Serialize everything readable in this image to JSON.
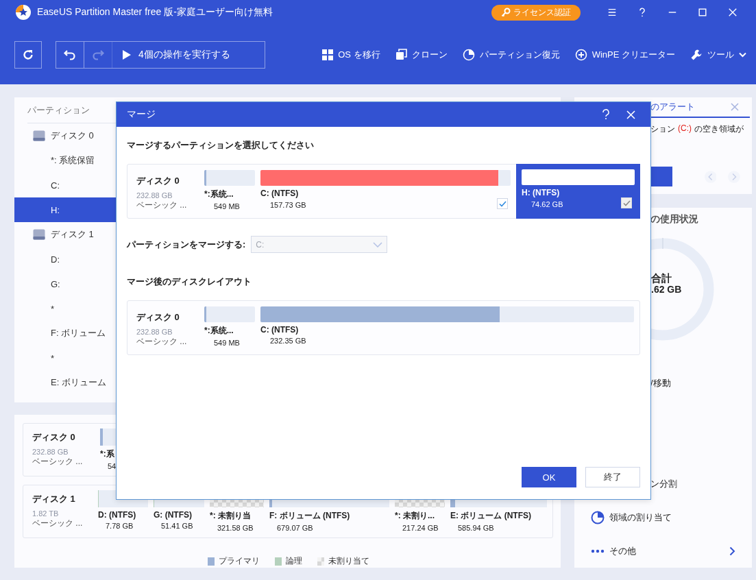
{
  "window": {
    "title": "EaseUS Partition Master free 版-家庭ユーザー向け無料",
    "license_button": "ライセンス認証"
  },
  "toolbar": {
    "run_button": "4個の操作を実行する",
    "redo_disabled": true,
    "actions": [
      {
        "kind": "migrate",
        "label": "OS を移行"
      },
      {
        "kind": "clone",
        "label": "クローン"
      },
      {
        "kind": "recover",
        "label": "パーティション復元"
      },
      {
        "kind": "winpe",
        "label": "WinPE クリエーター"
      },
      {
        "kind": "tools",
        "label": "ツール"
      }
    ]
  },
  "partition_list": {
    "header": "パーティション",
    "disks": [
      {
        "label": "ディスク 0",
        "selected": false,
        "children": [
          {
            "label": "*: 系统保留",
            "selected": false
          },
          {
            "label": "C:",
            "selected": false
          },
          {
            "label": "H:",
            "selected": true
          }
        ]
      },
      {
        "label": "ディスク 1",
        "selected": false,
        "children": [
          {
            "label": "D:",
            "selected": false
          },
          {
            "label": "G:",
            "selected": false
          },
          {
            "label": "*",
            "selected": false
          },
          {
            "label": "F: ボリューム",
            "selected": false
          },
          {
            "label": "*",
            "selected": false
          },
          {
            "label": "E: ボリューム",
            "selected": false
          }
        ]
      }
    ]
  },
  "disk_map": {
    "disks": [
      {
        "name": "ディスク 0",
        "size": "232.88 GB",
        "type": "ベーシック ...",
        "partitions": [
          {
            "kind": "primary",
            "label": "*:系",
            "size": "54",
            "level": 0.06
          }
        ]
      },
      {
        "name": "ディスク 1",
        "size": "1.82 TB",
        "type": "ベーシック ...",
        "partitions": [
          {
            "kind": "logical",
            "label": "D: (NTFS)",
            "size": "7.78 GB",
            "level": 0.02
          },
          {
            "kind": "logical",
            "label": "G: (NTFS)",
            "size": "51.41 GB",
            "level": 0.02
          },
          {
            "kind": "unallocated",
            "label": "*: 未割り当",
            "size": "321.58 GB"
          },
          {
            "kind": "primary",
            "label": "F: ボリューム (NTFS)",
            "size": "679.07 GB",
            "level": 0.02
          },
          {
            "kind": "unallocated",
            "label": "*: 未割り...",
            "size": "217.24 GB"
          },
          {
            "kind": "primary",
            "label": "E: ボリューム (NTFS)",
            "size": "585.94 GB",
            "level": 0.05
          }
        ]
      }
    ],
    "legend": [
      {
        "kind": "primary",
        "label": "プライマリ"
      },
      {
        "kind": "logical",
        "label": "論理"
      },
      {
        "kind": "unallocated",
        "label": "未割り当て"
      }
    ]
  },
  "alert": {
    "title": "のアラート",
    "message": [
      {
        "text": "ション",
        "highlight": false
      },
      {
        "text": "(C:)",
        "highlight": true
      },
      {
        "text": "の空き領域が",
        "highlight": false
      }
    ]
  },
  "usage": {
    "title": "の使用状況",
    "total_label": "合計",
    "total_value": ".62 GB",
    "actions": [
      {
        "kind": "cut",
        "label": "/移動"
      },
      {
        "kind": "cut",
        "label": "ン分割"
      },
      {
        "kind": "allocate",
        "label": "領域の割り当て"
      },
      {
        "kind": "more",
        "label": "その他"
      }
    ]
  },
  "dialog": {
    "title": "マージ",
    "select_heading": "マージするパーティションを選択してください",
    "source": {
      "name": "ディスク 0",
      "size": "232.88 GB",
      "type": "ベーシック ...",
      "partitions": [
        {
          "kind": "primary",
          "label": "*:系统...",
          "size": "549 MB",
          "level": 0.04,
          "selected": false
        },
        {
          "kind": "target",
          "label": "C: (NTFS)",
          "size": "157.73 GB",
          "level": 0.95,
          "selected": false,
          "checked": true
        },
        {
          "kind": "source",
          "label": "H: (NTFS)",
          "size": "74.62 GB",
          "selected": true,
          "checked": true
        }
      ]
    },
    "merge_target": {
      "label": "パーティションをマージする:",
      "value": "C:",
      "disabled": true
    },
    "result_heading": "マージ後のディスクレイアウト",
    "result": {
      "name": "ディスク 0",
      "size": "232.88 GB",
      "type": "ベーシック ...",
      "partitions": [
        {
          "kind": "primary",
          "label": "*:系统...",
          "size": "549 MB",
          "level": 0.04
        },
        {
          "kind": "primary",
          "label": "C: (NTFS)",
          "size": "232.35 GB",
          "level": 0.64
        }
      ]
    },
    "buttons": [
      {
        "kind": "primary",
        "label": "OK"
      },
      {
        "kind": "secondary",
        "label": "終了"
      }
    ]
  }
}
